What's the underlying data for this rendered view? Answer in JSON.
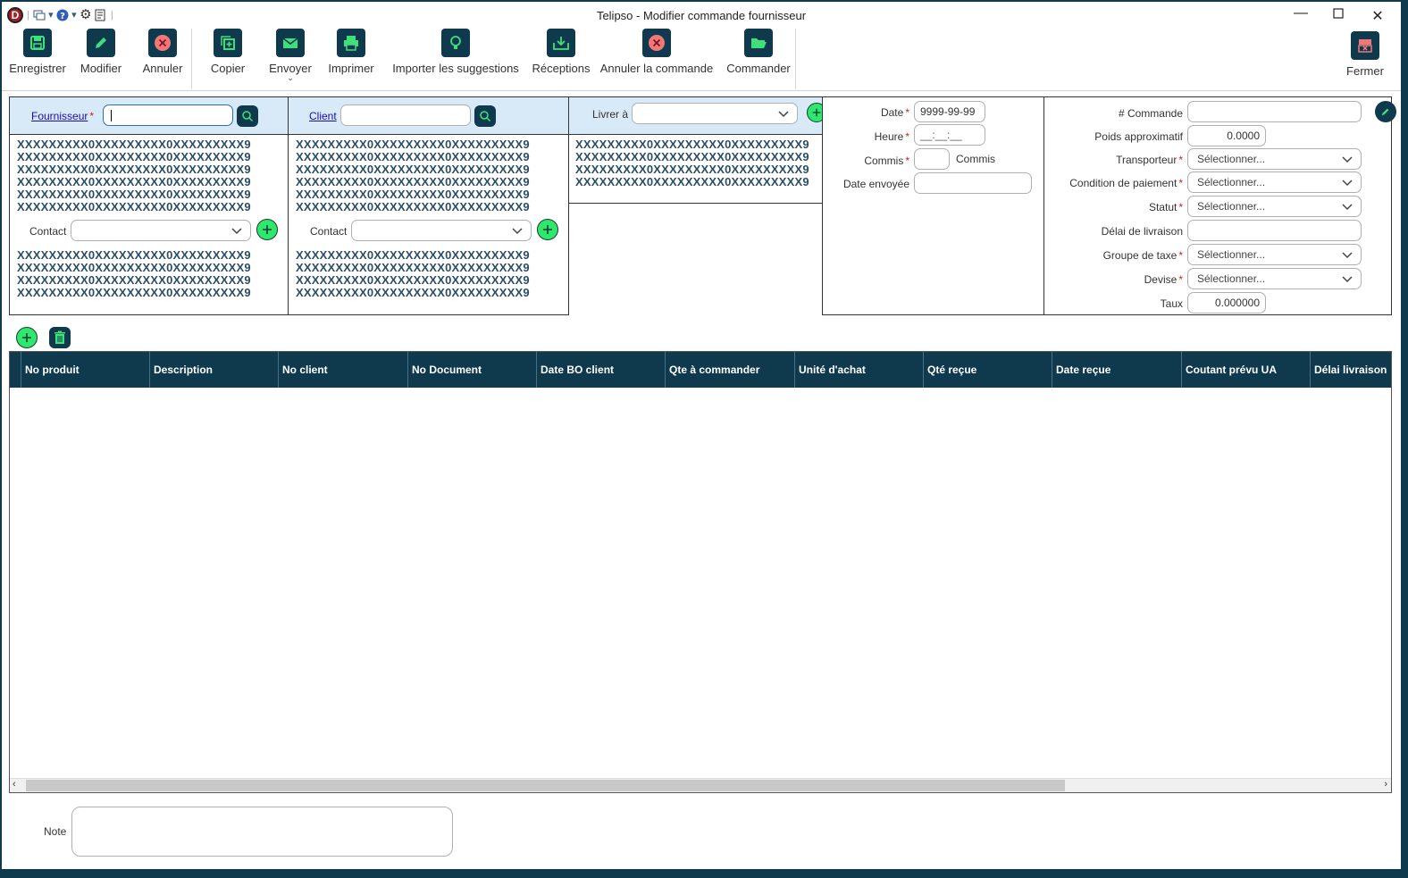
{
  "app": {
    "title": "Telipso - Modifier commande fournisseur"
  },
  "toolbar": {
    "save": "Enregistrer",
    "modify": "Modifier",
    "cancel": "Annuler",
    "copy": "Copier",
    "send": "Envoyer",
    "print": "Imprimer",
    "import": "Importer les suggestions",
    "receptions": "Réceptions",
    "cancel_order": "Annuler la commande",
    "order": "Commander",
    "close": "Fermer"
  },
  "supplier": {
    "label": "Fournisseur",
    "address_lines": [
      "XXXXXXXXX0XXXXXXXXX0XXXXXXXXX9",
      "XXXXXXXXX0XXXXXXXXX0XXXXXXXXX9",
      "XXXXXXXXX0XXXXXXXXX0XXXXXXXXX9",
      "XXXXXXXXX0XXXXXXXXX0XXXXXXXXX9",
      "XXXXXXXXX0XXXXXXXXX0XXXXXXXXX9",
      "XXXXXXXXX0XXXXXXXXX0XXXXXXXXX9"
    ],
    "contact_label": "Contact",
    "contact_lines": [
      "XXXXXXXXX0XXXXXXXXX0XXXXXXXXX9",
      "XXXXXXXXX0XXXXXXXXX0XXXXXXXXX9",
      "XXXXXXXXX0XXXXXXXXX0XXXXXXXXX9",
      "XXXXXXXXX0XXXXXXXXX0XXXXXXXXX9"
    ]
  },
  "client": {
    "label": "Client",
    "address_lines": [
      "XXXXXXXXX0XXXXXXXXX0XXXXXXXXX9",
      "XXXXXXXXX0XXXXXXXXX0XXXXXXXXX9",
      "XXXXXXXXX0XXXXXXXXX0XXXXXXXXX9",
      "XXXXXXXXX0XXXXXXXXX0XXXXXXXXX9",
      "XXXXXXXXX0XXXXXXXXX0XXXXXXXXX9",
      "XXXXXXXXX0XXXXXXXXX0XXXXXXXXX9"
    ],
    "contact_label": "Contact",
    "contact_lines": [
      "XXXXXXXXX0XXXXXXXXX0XXXXXXXXX9",
      "XXXXXXXXX0XXXXXXXXX0XXXXXXXXX9",
      "XXXXXXXXX0XXXXXXXXX0XXXXXXXXX9",
      "XXXXXXXXX0XXXXXXXXX0XXXXXXXXX9"
    ]
  },
  "deliver": {
    "label": "Livrer à",
    "lines": [
      "XXXXXXXXX0XXXXXXXXX0XXXXXXXXX9",
      "XXXXXXXXX0XXXXXXXXX0XXXXXXXXX9",
      "XXXXXXXXX0XXXXXXXXX0XXXXXXXXX9",
      "XXXXXXXXX0XXXXXXXXX0XXXXXXXXX9"
    ]
  },
  "dates": {
    "date_label": "Date",
    "date_value": "9999-99-99",
    "time_label": "Heure",
    "time_value": "__:__:__",
    "clerk_label": "Commis",
    "clerk_name": "Commis",
    "sent_label": "Date envoyée"
  },
  "order": {
    "number_label": "# Commande",
    "weight_label": "Poids approximatif",
    "weight_value": "0.0000",
    "carrier_label": "Transporteur",
    "payment_label": "Condition de paiement",
    "status_label": "Statut",
    "delay_label": "Délai de livraison",
    "tax_label": "Groupe de taxe",
    "currency_label": "Devise",
    "rate_label": "Taux",
    "rate_value": "0.000000",
    "select_placeholder": "Sélectionner..."
  },
  "grid": {
    "columns": [
      "No produit",
      "Description",
      "No client",
      "No Document",
      "Date BO client",
      "Qte à commander",
      "Unité d'achat",
      "Qté reçue",
      "Date reçue",
      "Coutant prévu UA",
      "Délai livraison"
    ]
  },
  "note": {
    "label": "Note"
  }
}
